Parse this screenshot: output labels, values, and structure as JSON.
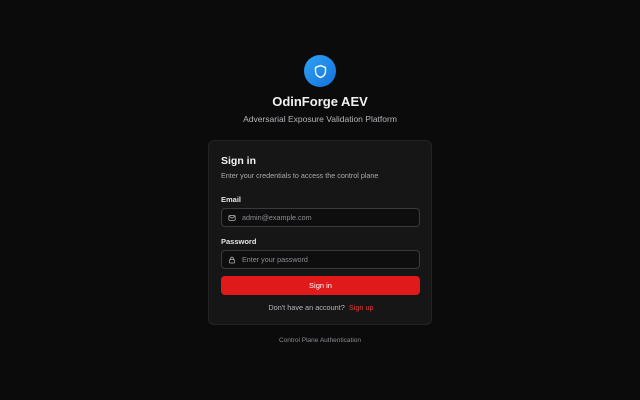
{
  "brand": {
    "title": "OdinForge AEV",
    "subtitle": "Adversarial Exposure Validation Platform",
    "logo_icon": "shield-icon",
    "logo_color": "#1f8be8"
  },
  "card": {
    "title": "Sign in",
    "description": "Enter your credentials to access the control plane",
    "email": {
      "label": "Email",
      "placeholder": "admin@example.com",
      "value": "",
      "icon": "mail-icon"
    },
    "password": {
      "label": "Password",
      "placeholder": "Enter your password",
      "value": "",
      "icon": "lock-icon"
    },
    "submit_label": "Sign in",
    "signup_prompt": "Don't have an account?",
    "signup_link": "Sign up"
  },
  "footer": {
    "text": "Control Plane Authentication"
  },
  "colors": {
    "background": "#0b0b0c",
    "card": "#161617",
    "accent": "#e01a1a",
    "link": "#e53a3a"
  }
}
